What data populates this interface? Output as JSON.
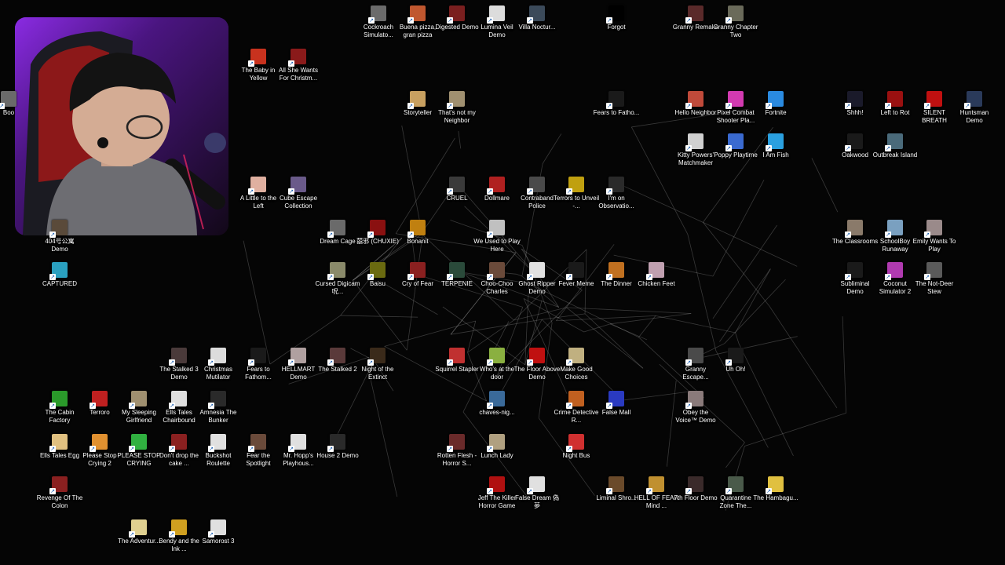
{
  "desktop": {
    "icons": [
      {
        "label": "Cockroach Simulato...",
        "color": "#6b6b6b"
      },
      {
        "label": "Buena pizza, gran pizza",
        "color": "#c0572f"
      },
      {
        "label": "Digested Demo",
        "color": "#7a1f1f"
      },
      {
        "label": "Lumina Veil Demo",
        "color": "#dcdcdc"
      },
      {
        "label": "Villa Noctur...",
        "color": "#3b4a5a"
      },
      {
        "label": "Forgot",
        "color": "#000000"
      },
      {
        "label": "Granny Remake",
        "color": "#5a2a2a"
      },
      {
        "label": "Granny Chapter Two",
        "color": "#6a6a5a"
      },
      {
        "label": "The Baby in Yellow",
        "color": "#c8321e"
      },
      {
        "label": "All She Wants For Christm...",
        "color": "#8a1a1a"
      },
      {
        "label": "Storyteller",
        "color": "#c8a060"
      },
      {
        "label": "That's not my Neighbor",
        "color": "#a09070"
      },
      {
        "label": "Fears to Fatho...",
        "color": "#1a1a1a"
      },
      {
        "label": "Hello Neighbor",
        "color": "#c04a3a"
      },
      {
        "label": "Pixel Combat Shooter Pla...",
        "color": "#d23ab0"
      },
      {
        "label": "Fortnite",
        "color": "#2a8ae0"
      },
      {
        "label": "Shhh!",
        "color": "#1a1a2a"
      },
      {
        "label": "Left to Rot",
        "color": "#9a1010"
      },
      {
        "label": "SILENT BREATH",
        "color": "#c01010"
      },
      {
        "label": "Huntsman Demo",
        "color": "#2a3a5a"
      },
      {
        "label": "Kitty Powers' Matchmaker",
        "color": "#d0d0d0"
      },
      {
        "label": "Poppy Playtime",
        "color": "#3a6ad0"
      },
      {
        "label": "I Am Fish",
        "color": "#2aa0e0"
      },
      {
        "label": "Oakwood",
        "color": "#1a1a1a"
      },
      {
        "label": "Outbreak Island",
        "color": "#4a6a7a"
      },
      {
        "label": "A Little to the Left",
        "color": "#e0b0a0"
      },
      {
        "label": "Cube Escape Collection",
        "color": "#6a5a8a"
      },
      {
        "label": "CRUEL",
        "color": "#3a3a3a"
      },
      {
        "label": "Dollmare",
        "color": "#b02020"
      },
      {
        "label": "Contraband Police",
        "color": "#4a4a4a"
      },
      {
        "label": "Terrors to Unveil -...",
        "color": "#c0a010"
      },
      {
        "label": "I'm on Observatio...",
        "color": "#2a2a2a"
      },
      {
        "label": "404号公寓 Demo",
        "color": "#5a4a3a"
      },
      {
        "label": "Dream Cage",
        "color": "#6a6a6a"
      },
      {
        "label": "囍邪 (CHUXIE)",
        "color": "#8a1010"
      },
      {
        "label": "Bonanit",
        "color": "#c08010"
      },
      {
        "label": "We Used to Play Here",
        "color": "#c0c0c0"
      },
      {
        "label": "The Classrooms",
        "color": "#8a7a6a"
      },
      {
        "label": "SchoolBoy Runaway",
        "color": "#7aa0c0"
      },
      {
        "label": "Emily Wants To Play",
        "color": "#9a8a8a"
      },
      {
        "label": "CAPTURED",
        "color": "#2aa0c0"
      },
      {
        "label": "Cursed Digicam 呪...",
        "color": "#8a8a6a"
      },
      {
        "label": "Baisu",
        "color": "#6a6a10"
      },
      {
        "label": "Cry of Fear",
        "color": "#8a2020"
      },
      {
        "label": "TERPENIE",
        "color": "#2a4a3a"
      },
      {
        "label": "Choo-Choo Charles",
        "color": "#6a4a3a"
      },
      {
        "label": "Ghost Ripper Demo",
        "color": "#e0e0e0"
      },
      {
        "label": "Fever Meme",
        "color": "#1a1a1a"
      },
      {
        "label": "The Dinner",
        "color": "#c07020"
      },
      {
        "label": "Chicken Feet",
        "color": "#c0a0b0"
      },
      {
        "label": "Subliminal Demo",
        "color": "#1a1a1a"
      },
      {
        "label": "Coconut Simulator 2",
        "color": "#b03ab0"
      },
      {
        "label": "The Not-Deer Stew",
        "color": "#5a5a5a"
      },
      {
        "label": "The Stalked 3 Demo",
        "color": "#4a3a3a"
      },
      {
        "label": "Christmas Mutilator",
        "color": "#dcdcdc"
      },
      {
        "label": "Fears to Fathom...",
        "color": "#1a1a1a"
      },
      {
        "label": "HELLMART Demo",
        "color": "#b0a0a0"
      },
      {
        "label": "The Stalked 2",
        "color": "#5a3a3a"
      },
      {
        "label": "Night of the Extinct",
        "color": "#3a2a1a"
      },
      {
        "label": "Squirrel Stapler",
        "color": "#c03030"
      },
      {
        "label": "Who's at the door",
        "color": "#8ab040"
      },
      {
        "label": "The Floor Above Demo",
        "color": "#c01010"
      },
      {
        "label": "Make Good Choices",
        "color": "#c0b080"
      },
      {
        "label": "Granny Escape...",
        "color": "#4a4a4a"
      },
      {
        "label": "Uh Oh!",
        "color": "#1a1a1a"
      },
      {
        "label": "The Cabin Factory",
        "color": "#2a9a2a"
      },
      {
        "label": "Terroro",
        "color": "#c02020"
      },
      {
        "label": "My Sleeping Girlfriend",
        "color": "#a09070"
      },
      {
        "label": "Ells Tales Chairbound",
        "color": "#e0e0e0"
      },
      {
        "label": "Amnesia The Bunker",
        "color": "#2a2a2a"
      },
      {
        "label": "chaves-nig...",
        "color": "#3a6a9a"
      },
      {
        "label": "Crime Detective R...",
        "color": "#c06020"
      },
      {
        "label": "False Mall",
        "color": "#2a3ac0"
      },
      {
        "label": "Obey the Voice™ Demo",
        "color": "#8a7a7a"
      },
      {
        "label": "Ells Tales Egg",
        "color": "#e0c080"
      },
      {
        "label": "Please Stop Crying 2",
        "color": "#e09030"
      },
      {
        "label": "PLEASE STOP CRYING",
        "color": "#30b040"
      },
      {
        "label": "Don't drop the cake ...",
        "color": "#8a2020"
      },
      {
        "label": "Buckshot Roulette",
        "color": "#e0e0e0"
      },
      {
        "label": "Fear the Spotlight",
        "color": "#6a4a3a"
      },
      {
        "label": "Mr. Hopp's Playhous...",
        "color": "#e0e0e0"
      },
      {
        "label": "House 2 Demo",
        "color": "#2a2a2a"
      },
      {
        "label": "Rotten Flesh - Horror S...",
        "color": "#6a2a2a"
      },
      {
        "label": "Lunch Lady",
        "color": "#b0a080"
      },
      {
        "label": "Night Bus",
        "color": "#d03030"
      },
      {
        "label": "Revenge Of The Colon",
        "color": "#8a2020"
      },
      {
        "label": "Jeff The Killer Horror Game",
        "color": "#b01010"
      },
      {
        "label": "False Dream 偽夢",
        "color": "#e0e0e0"
      },
      {
        "label": "Liminal Shro...",
        "color": "#6a4a2a"
      },
      {
        "label": "HELL OF FEAR Mind ...",
        "color": "#c09030"
      },
      {
        "label": "7th Floor Demo",
        "color": "#3a2a2a"
      },
      {
        "label": "Quarantine Zone The...",
        "color": "#4a5a4a"
      },
      {
        "label": "The Hambagu...",
        "color": "#e0c040"
      },
      {
        "label": "The Adventur...",
        "color": "#e0d090"
      },
      {
        "label": "Bendy and the Ink ...",
        "color": "#d0a020"
      },
      {
        "label": "Samorost 3",
        "color": "#e0e0e0"
      },
      {
        "label": "Boo",
        "color": "#6a6a6a"
      }
    ]
  },
  "webcam": {
    "alt": "streamer webcam overlay"
  }
}
